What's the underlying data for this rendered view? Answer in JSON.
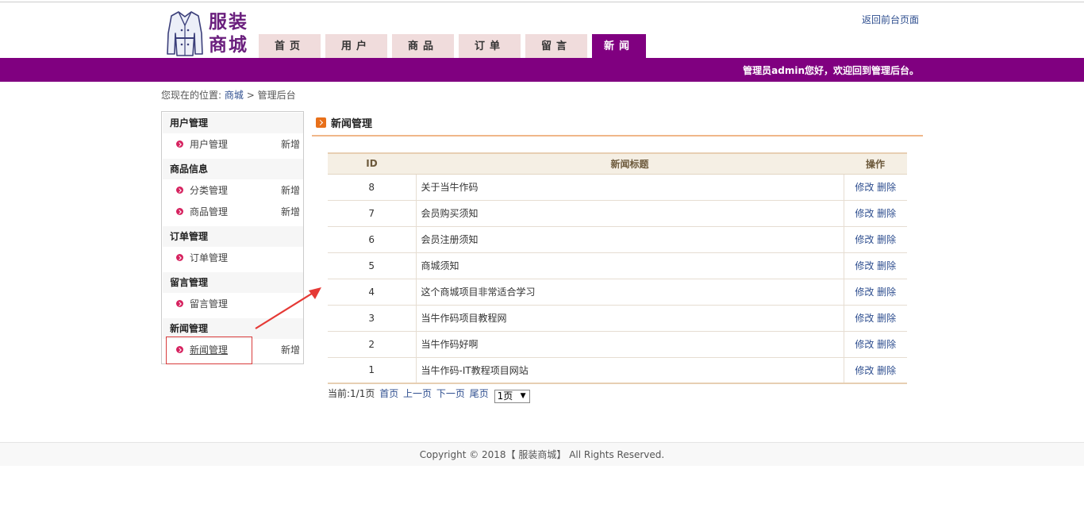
{
  "logo": {
    "line1": "服装",
    "line2": "商城"
  },
  "header": {
    "return_link": "返回前台页面"
  },
  "nav": {
    "tabs": [
      {
        "label": "首页"
      },
      {
        "label": "用户"
      },
      {
        "label": "商品"
      },
      {
        "label": "订单"
      },
      {
        "label": "留言"
      },
      {
        "label": "新闻"
      }
    ],
    "active": "新闻"
  },
  "welcome": "管理员admin您好，欢迎回到管理后台。",
  "breadcrumb": {
    "prefix": "您现在的位置:",
    "link": "商城",
    "sep": ">",
    "current": "管理后台"
  },
  "sidebar": {
    "groups": [
      {
        "title": "用户管理",
        "items": [
          {
            "label": "用户管理",
            "action": "新增"
          }
        ]
      },
      {
        "title": "商品信息",
        "items": [
          {
            "label": "分类管理",
            "action": "新增"
          },
          {
            "label": "商品管理",
            "action": "新增"
          }
        ]
      },
      {
        "title": "订单管理",
        "items": [
          {
            "label": "订单管理",
            "action": ""
          }
        ]
      },
      {
        "title": "留言管理",
        "items": [
          {
            "label": "留言管理",
            "action": ""
          }
        ]
      },
      {
        "title": "新闻管理",
        "items": [
          {
            "label": "新闻管理",
            "action": "新增"
          }
        ]
      }
    ]
  },
  "main": {
    "title": "新闻管理",
    "table": {
      "headers": {
        "id": "ID",
        "title": "新闻标题",
        "op": "操作"
      },
      "rows": [
        {
          "id": "8",
          "title": "关于当牛作码",
          "edit": "修改",
          "del": "删除"
        },
        {
          "id": "7",
          "title": "会员购买须知",
          "edit": "修改",
          "del": "删除"
        },
        {
          "id": "6",
          "title": "会员注册须知",
          "edit": "修改",
          "del": "删除"
        },
        {
          "id": "5",
          "title": "商城须知",
          "edit": "修改",
          "del": "删除"
        },
        {
          "id": "4",
          "title": "这个商城项目非常适合学习",
          "edit": "修改",
          "del": "删除"
        },
        {
          "id": "3",
          "title": "当牛作码项目教程网",
          "edit": "修改",
          "del": "删除"
        },
        {
          "id": "2",
          "title": "当牛作码好啊",
          "edit": "修改",
          "del": "删除"
        },
        {
          "id": "1",
          "title": "当牛作码-IT教程项目网站",
          "edit": "修改",
          "del": "删除"
        }
      ]
    },
    "pager": {
      "status": "当前:1/1页",
      "first": "首页",
      "prev": "上一页",
      "next": "下一页",
      "last": "尾页",
      "page_select": "1页"
    }
  },
  "footer": "Copyright © 2018【 服装商城】 All Rights Reserved.",
  "colors": {
    "brand": "#800080",
    "nav_inactive": "#f0dcdc",
    "link": "#2e4e8f",
    "accent_orange": "#e8701a",
    "annotation_red": "#e53935"
  }
}
